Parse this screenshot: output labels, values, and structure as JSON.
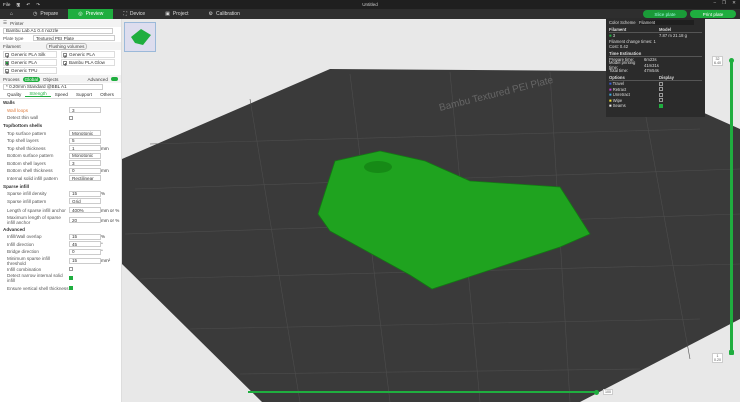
{
  "topbar": {
    "file": "File",
    "title": "Untitled"
  },
  "nav": [
    {
      "label": "Prepare"
    },
    {
      "label": "Preview"
    },
    {
      "label": "Device"
    },
    {
      "label": "Project"
    },
    {
      "label": "Calibration"
    }
  ],
  "actions": {
    "slice": "Slice plate",
    "print": "Print plate"
  },
  "printer": {
    "section": "Printer",
    "name": "Bambu Lab A1 0.4 nozzle",
    "plate_label": "Plate type",
    "plate": "Textured PEI Plate"
  },
  "filament": {
    "section": "Filament",
    "flush": "Flushing volumes",
    "items": [
      {
        "n": "1",
        "name": "Generic PLA Silk",
        "color": "#ffffff"
      },
      {
        "n": "2",
        "name": "Generic PLA",
        "color": "#ffffff"
      },
      {
        "n": "3",
        "name": "Generic PLA",
        "color": "#1fae3f"
      },
      {
        "n": "4",
        "name": "Bambu PLA Glow",
        "color": "#ffffff"
      },
      {
        "n": "5",
        "name": "Generic TPU",
        "color": "#ffffff"
      }
    ]
  },
  "process": {
    "section": "Process",
    "global": "Global",
    "objects": "Objects",
    "advanced": "Advanced",
    "preset": "* 0.20mm Standard @BBL A1",
    "tabs": [
      "Quality",
      "Strength",
      "Speed",
      "Support",
      "Others"
    ]
  },
  "walls": {
    "title": "Walls",
    "rows": [
      {
        "label": "Wall loops",
        "value": "3"
      },
      {
        "label": "Detect thin wall",
        "value": ""
      }
    ]
  },
  "shells": {
    "title": "Top/bottom shells",
    "rows": [
      {
        "label": "Top surface pattern",
        "value": "Monotonic"
      },
      {
        "label": "Top shell layers",
        "value": "5"
      },
      {
        "label": "Top shell thickness",
        "value": "1",
        "unit": "mm"
      },
      {
        "label": "Bottom surface pattern",
        "value": "Monotonic"
      },
      {
        "label": "Bottom shell layers",
        "value": "3"
      },
      {
        "label": "Bottom shell thickness",
        "value": "0",
        "unit": "mm"
      },
      {
        "label": "Internal solid infill pattern",
        "value": "Rectilinear"
      }
    ]
  },
  "infill": {
    "title": "Sparse infill",
    "rows": [
      {
        "label": "Sparse infill density",
        "value": "15",
        "unit": "%"
      },
      {
        "label": "Sparse infill pattern",
        "value": "Grid"
      },
      {
        "label": "Length of sparse infill anchor",
        "value": "400%",
        "unit": "mm or %"
      },
      {
        "label": "Maximum length of sparse infill anchor",
        "value": "20",
        "unit": "mm or %"
      }
    ]
  },
  "advanced": {
    "title": "Advanced",
    "rows": [
      {
        "label": "Infill/Wall overlap",
        "value": "15",
        "unit": "%"
      },
      {
        "label": "Infill direction",
        "value": "45",
        "unit": "°"
      },
      {
        "label": "Bridge direction",
        "value": "0",
        "unit": "°"
      },
      {
        "label": "Minimum sparse infill threshold",
        "value": "15",
        "unit": "mm²"
      }
    ],
    "checks": [
      {
        "label": "Infill combination",
        "on": false
      },
      {
        "label": "Detect narrow internal solid infill",
        "on": true
      },
      {
        "label": "Ensure vertical shell thickness",
        "on": true
      }
    ]
  },
  "legend": {
    "scheme_label": "Color Scheme",
    "scheme": "Filament",
    "col1": "Filament",
    "col2": "Model",
    "filament_no": "3",
    "model_val": "7.87 m   21.18 g",
    "change_times": "Filament change times: 1",
    "cost": "Cost: 0.42",
    "time_title": "Time Estimation",
    "prepare": [
      "Prepare time:",
      "6m23s"
    ],
    "model_time": [
      "Model printing time:",
      "41m31s"
    ],
    "total": [
      "Total time:",
      "47m54s"
    ],
    "options": "Options",
    "display": "Display",
    "opts": [
      {
        "name": "Travel",
        "color": "#3a5fd9"
      },
      {
        "name": "Retract",
        "color": "#c33fd0"
      },
      {
        "name": "Unretract",
        "color": "#3fa9e0"
      },
      {
        "name": "Wipe",
        "color": "#f2e030"
      },
      {
        "name": "Seams",
        "color": "#e8e8e8"
      }
    ]
  },
  "sliders": {
    "layer_top": "32",
    "layer_top_h": "6.40",
    "layer_bottom": "1",
    "layer_bottom_h": "0.20",
    "move": "100"
  },
  "plate_text": "Bambu Textured PEI Plate"
}
